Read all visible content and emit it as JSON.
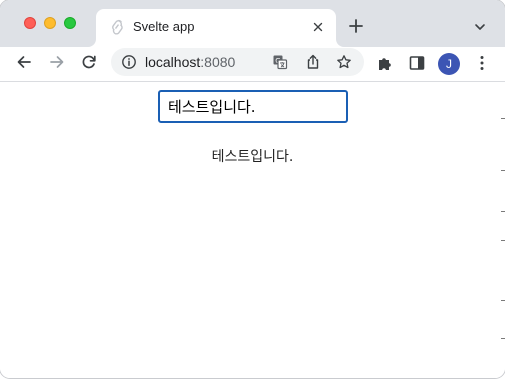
{
  "window": {
    "traffic_lights": [
      "close",
      "minimize",
      "maximize"
    ]
  },
  "tab": {
    "title": "Svelte app",
    "favicon_icon": "svelte-icon",
    "close_icon": "close-icon"
  },
  "tabstrip": {
    "new_tab_icon": "plus-icon",
    "tab_search_icon": "chevron-down-icon"
  },
  "toolbar": {
    "back_icon": "arrow-left-icon",
    "forward_icon": "arrow-right-icon",
    "reload_icon": "reload-icon",
    "site_info_icon": "info-icon",
    "url_host": "localhost",
    "url_port": ":8080",
    "translate_icon": "translate-icon",
    "share_icon": "share-icon",
    "bookmark_icon": "star-icon",
    "extensions_icon": "puzzle-icon",
    "sidepanel_icon": "sidepanel-icon",
    "profile_initial": "J",
    "menu_icon": "kebab-menu-icon"
  },
  "page": {
    "input_value": "테스트입니다.",
    "echo_text": "테스트입니다."
  },
  "colors": {
    "tabstrip_bg": "#dee1e6",
    "input_border": "#1a5fb4",
    "avatar_bg": "#3c55b4"
  }
}
